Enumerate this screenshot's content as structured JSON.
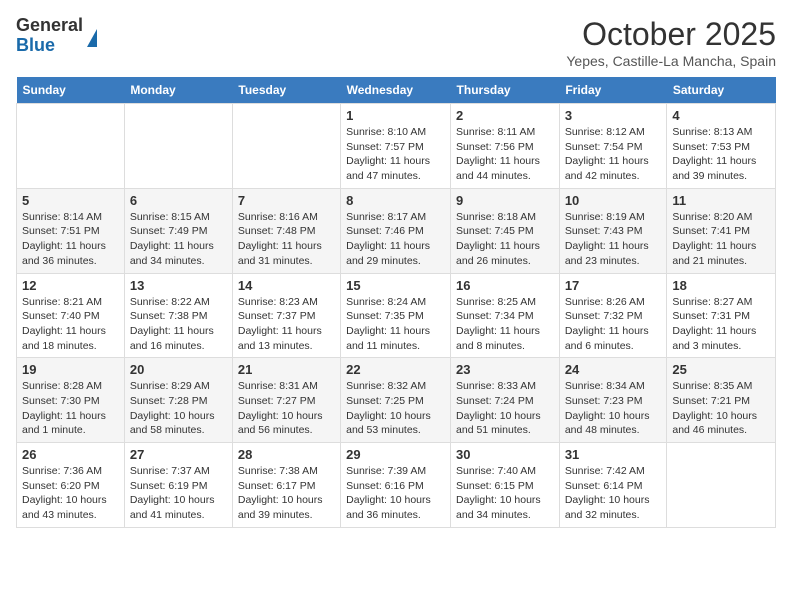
{
  "header": {
    "logo_general": "General",
    "logo_blue": "Blue",
    "month_title": "October 2025",
    "location": "Yepes, Castille-La Mancha, Spain"
  },
  "weekdays": [
    "Sunday",
    "Monday",
    "Tuesday",
    "Wednesday",
    "Thursday",
    "Friday",
    "Saturday"
  ],
  "weeks": [
    [
      {
        "day": "",
        "info": ""
      },
      {
        "day": "",
        "info": ""
      },
      {
        "day": "",
        "info": ""
      },
      {
        "day": "1",
        "info": "Sunrise: 8:10 AM\nSunset: 7:57 PM\nDaylight: 11 hours and 47 minutes."
      },
      {
        "day": "2",
        "info": "Sunrise: 8:11 AM\nSunset: 7:56 PM\nDaylight: 11 hours and 44 minutes."
      },
      {
        "day": "3",
        "info": "Sunrise: 8:12 AM\nSunset: 7:54 PM\nDaylight: 11 hours and 42 minutes."
      },
      {
        "day": "4",
        "info": "Sunrise: 8:13 AM\nSunset: 7:53 PM\nDaylight: 11 hours and 39 minutes."
      }
    ],
    [
      {
        "day": "5",
        "info": "Sunrise: 8:14 AM\nSunset: 7:51 PM\nDaylight: 11 hours and 36 minutes."
      },
      {
        "day": "6",
        "info": "Sunrise: 8:15 AM\nSunset: 7:49 PM\nDaylight: 11 hours and 34 minutes."
      },
      {
        "day": "7",
        "info": "Sunrise: 8:16 AM\nSunset: 7:48 PM\nDaylight: 11 hours and 31 minutes."
      },
      {
        "day": "8",
        "info": "Sunrise: 8:17 AM\nSunset: 7:46 PM\nDaylight: 11 hours and 29 minutes."
      },
      {
        "day": "9",
        "info": "Sunrise: 8:18 AM\nSunset: 7:45 PM\nDaylight: 11 hours and 26 minutes."
      },
      {
        "day": "10",
        "info": "Sunrise: 8:19 AM\nSunset: 7:43 PM\nDaylight: 11 hours and 23 minutes."
      },
      {
        "day": "11",
        "info": "Sunrise: 8:20 AM\nSunset: 7:41 PM\nDaylight: 11 hours and 21 minutes."
      }
    ],
    [
      {
        "day": "12",
        "info": "Sunrise: 8:21 AM\nSunset: 7:40 PM\nDaylight: 11 hours and 18 minutes."
      },
      {
        "day": "13",
        "info": "Sunrise: 8:22 AM\nSunset: 7:38 PM\nDaylight: 11 hours and 16 minutes."
      },
      {
        "day": "14",
        "info": "Sunrise: 8:23 AM\nSunset: 7:37 PM\nDaylight: 11 hours and 13 minutes."
      },
      {
        "day": "15",
        "info": "Sunrise: 8:24 AM\nSunset: 7:35 PM\nDaylight: 11 hours and 11 minutes."
      },
      {
        "day": "16",
        "info": "Sunrise: 8:25 AM\nSunset: 7:34 PM\nDaylight: 11 hours and 8 minutes."
      },
      {
        "day": "17",
        "info": "Sunrise: 8:26 AM\nSunset: 7:32 PM\nDaylight: 11 hours and 6 minutes."
      },
      {
        "day": "18",
        "info": "Sunrise: 8:27 AM\nSunset: 7:31 PM\nDaylight: 11 hours and 3 minutes."
      }
    ],
    [
      {
        "day": "19",
        "info": "Sunrise: 8:28 AM\nSunset: 7:30 PM\nDaylight: 11 hours and 1 minute."
      },
      {
        "day": "20",
        "info": "Sunrise: 8:29 AM\nSunset: 7:28 PM\nDaylight: 10 hours and 58 minutes."
      },
      {
        "day": "21",
        "info": "Sunrise: 8:31 AM\nSunset: 7:27 PM\nDaylight: 10 hours and 56 minutes."
      },
      {
        "day": "22",
        "info": "Sunrise: 8:32 AM\nSunset: 7:25 PM\nDaylight: 10 hours and 53 minutes."
      },
      {
        "day": "23",
        "info": "Sunrise: 8:33 AM\nSunset: 7:24 PM\nDaylight: 10 hours and 51 minutes."
      },
      {
        "day": "24",
        "info": "Sunrise: 8:34 AM\nSunset: 7:23 PM\nDaylight: 10 hours and 48 minutes."
      },
      {
        "day": "25",
        "info": "Sunrise: 8:35 AM\nSunset: 7:21 PM\nDaylight: 10 hours and 46 minutes."
      }
    ],
    [
      {
        "day": "26",
        "info": "Sunrise: 7:36 AM\nSunset: 6:20 PM\nDaylight: 10 hours and 43 minutes."
      },
      {
        "day": "27",
        "info": "Sunrise: 7:37 AM\nSunset: 6:19 PM\nDaylight: 10 hours and 41 minutes."
      },
      {
        "day": "28",
        "info": "Sunrise: 7:38 AM\nSunset: 6:17 PM\nDaylight: 10 hours and 39 minutes."
      },
      {
        "day": "29",
        "info": "Sunrise: 7:39 AM\nSunset: 6:16 PM\nDaylight: 10 hours and 36 minutes."
      },
      {
        "day": "30",
        "info": "Sunrise: 7:40 AM\nSunset: 6:15 PM\nDaylight: 10 hours and 34 minutes."
      },
      {
        "day": "31",
        "info": "Sunrise: 7:42 AM\nSunset: 6:14 PM\nDaylight: 10 hours and 32 minutes."
      },
      {
        "day": "",
        "info": ""
      }
    ]
  ]
}
